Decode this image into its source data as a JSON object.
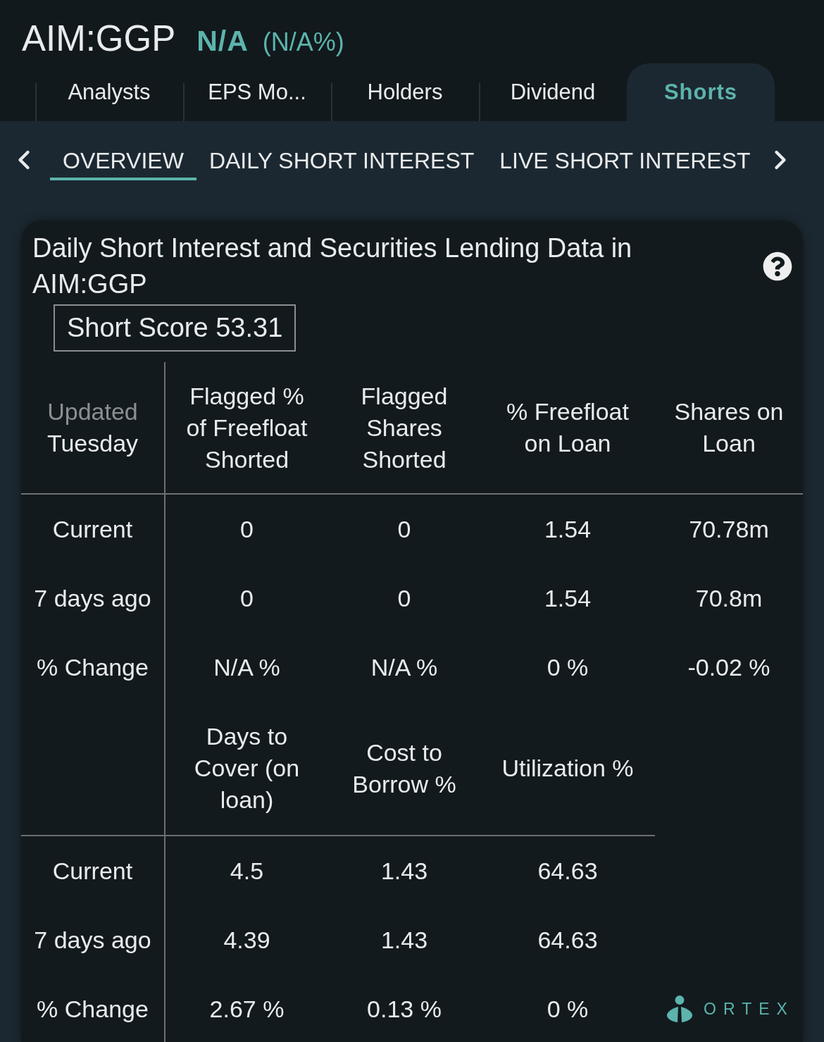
{
  "header": {
    "symbol": "AIM:GGP",
    "quote": {
      "value": "N/A",
      "change": "(N/A%)"
    }
  },
  "tabs": [
    {
      "label": "Analysts",
      "selected": false
    },
    {
      "label": "EPS Mo...",
      "selected": false
    },
    {
      "label": "Holders",
      "selected": false
    },
    {
      "label": "Dividend",
      "selected": false
    },
    {
      "label": "Shorts",
      "selected": true
    }
  ],
  "subtabs": [
    {
      "label": "OVERVIEW",
      "selected": true
    },
    {
      "label": "DAILY SHORT INTEREST",
      "selected": false
    },
    {
      "label": "LIVE SHORT INTEREST",
      "selected": false
    }
  ],
  "card": {
    "title": "Daily Short Interest and Securities Lending Data in AIM:GGP",
    "short_score": "Short Score 53.31",
    "tables": [
      {
        "corner": {
          "label": "Updated",
          "value": "Tuesday"
        },
        "columns": [
          "Flagged % of Freefloat Shorted",
          "Flagged Shares Shorted",
          "% Freefloat on Loan",
          "Shares on Loan"
        ],
        "rows": [
          {
            "label": "Current",
            "cells": [
              "0",
              "0",
              "1.54",
              "70.78m"
            ]
          },
          {
            "label": "7 days ago",
            "cells": [
              "0",
              "0",
              "1.54",
              "70.8m"
            ]
          },
          {
            "label": "% Change",
            "cells": [
              "N/A %",
              "N/A %",
              "0 %",
              "-0.02 %"
            ]
          }
        ]
      },
      {
        "columns": [
          "Days to Cover (on loan)",
          "Cost to Borrow %",
          "Utilization %"
        ],
        "rows": [
          {
            "label": "Current",
            "cells": [
              "4.5",
              "1.43",
              "64.63"
            ]
          },
          {
            "label": "7 days ago",
            "cells": [
              "4.39",
              "1.43",
              "64.63"
            ]
          },
          {
            "label": "% Change",
            "cells": [
              "2.67 %",
              "0.13 %",
              "0 %"
            ]
          }
        ]
      }
    ],
    "logo": "ORTEX"
  }
}
